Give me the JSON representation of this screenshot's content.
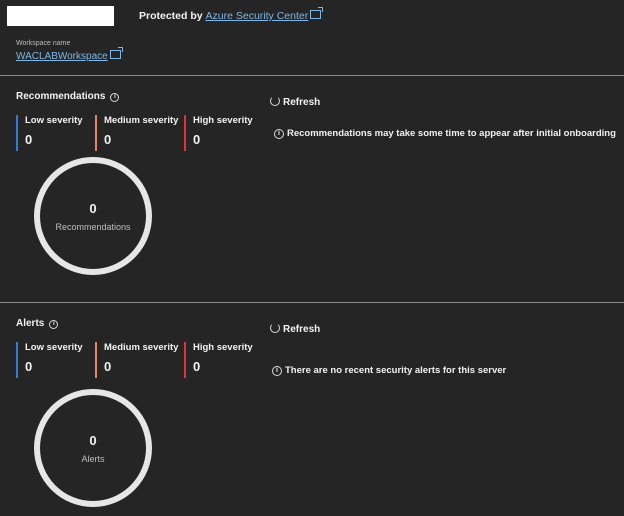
{
  "header": {
    "protected_prefix": "Protected by",
    "protected_link": "Azure Security Center"
  },
  "workspace": {
    "label": "Workspace name",
    "name": "WACLABWorkspace"
  },
  "recommendations": {
    "title": "Recommendations",
    "refresh_label": "Refresh",
    "severities": [
      {
        "label": "Low severity",
        "value": "0",
        "color": "#2f7bd6"
      },
      {
        "label": "Medium severity",
        "value": "0",
        "color": "#e8845a"
      },
      {
        "label": "High severity",
        "value": "0",
        "color": "#e0323e"
      }
    ],
    "note": "Recommendations may take some time to appear after initial onboarding",
    "ring_value": "0",
    "ring_caption": "Recommendations"
  },
  "alerts": {
    "title": "Alerts",
    "refresh_label": "Refresh",
    "severities": [
      {
        "label": "Low severity",
        "value": "0",
        "color": "#2f7bd6"
      },
      {
        "label": "Medium severity",
        "value": "0",
        "color": "#e8845a"
      },
      {
        "label": "High severity",
        "value": "0",
        "color": "#e0323e"
      }
    ],
    "note": "There are no recent security alerts for this server",
    "ring_value": "0",
    "ring_caption": "Alerts"
  }
}
